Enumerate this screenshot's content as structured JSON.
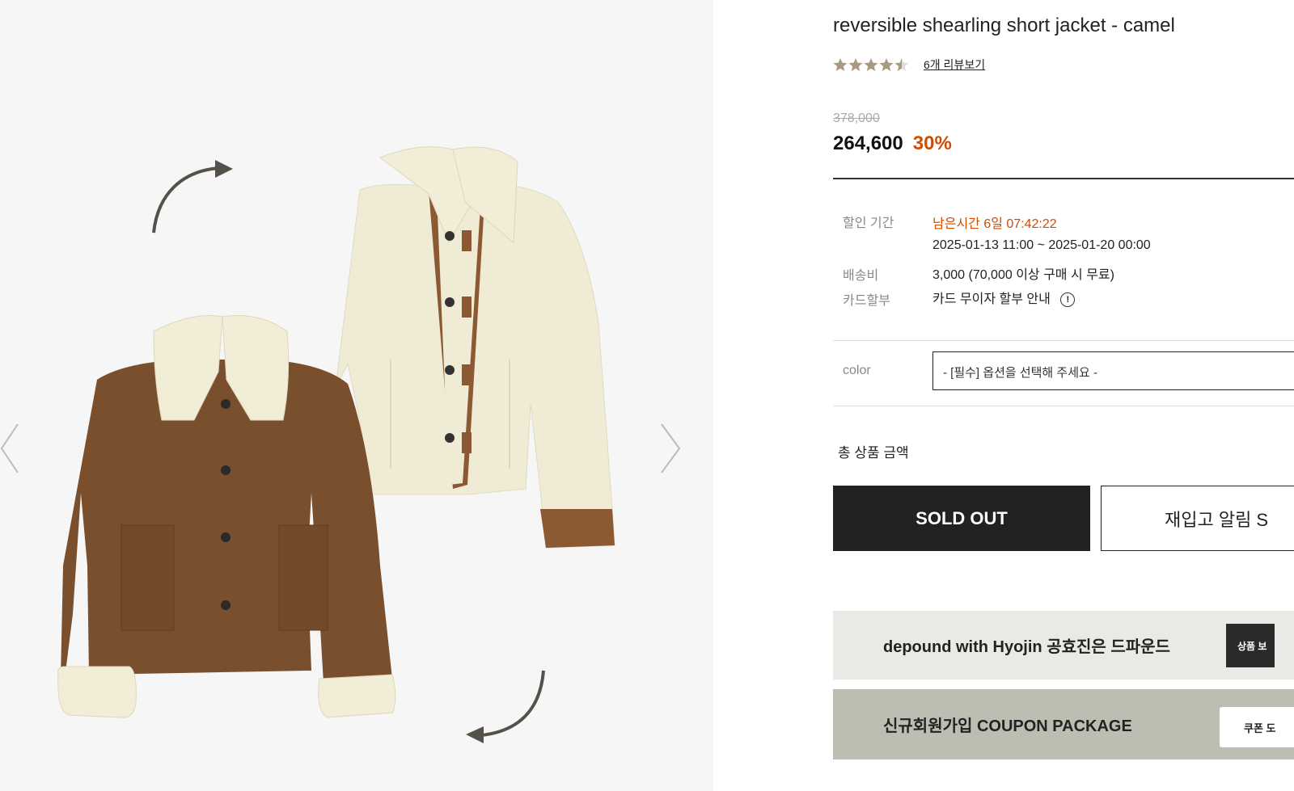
{
  "product": {
    "title": "reversible shearling short jacket - camel",
    "rating_value": 4.5,
    "rating_max": 5,
    "review_link": "6개 리뷰보기",
    "original_price": "378,000",
    "sale_price": "264,600",
    "discount": "30%"
  },
  "details": {
    "discount_period_label": "할인 기간",
    "countdown": "남은시간 6일 07:42:22",
    "period_range": "2025-01-13 11:00 ~ 2025-01-20 00:00",
    "shipping_label": "배송비",
    "shipping_value": "3,000 (70,000 이상 구매 시 무료)",
    "installment_label": "카드할부",
    "installment_value": "카드 무이자 할부 안내",
    "info_icon_glyph": "!"
  },
  "options": {
    "color_label": "color",
    "color_select_value": "- [필수] 옵션을 선택해 주세요 -"
  },
  "total": {
    "label": "총 상품 금액"
  },
  "buttons": {
    "soldout": "SOLD OUT",
    "restock": "재입고 알림 S"
  },
  "banners": {
    "hyojin_text": "depound with Hyojin  공효진은 드파운드",
    "hyojin_thumb": "상품 보",
    "coupon_text": "신규회원가입 COUPON PACKAGE",
    "coupon_thumb": "쿠폰 도"
  },
  "icons": {
    "prev": "chevron-left-icon",
    "next": "chevron-right-icon",
    "star": "star-icon",
    "rotate_top": "curved-arrow-icon",
    "rotate_bottom": "curved-arrow-icon"
  },
  "colors": {
    "accent": "#d14b00",
    "star": "#a89a82",
    "dark_button": "#222222",
    "camel": "#7a4f2d",
    "shearling": "#efebd4"
  }
}
